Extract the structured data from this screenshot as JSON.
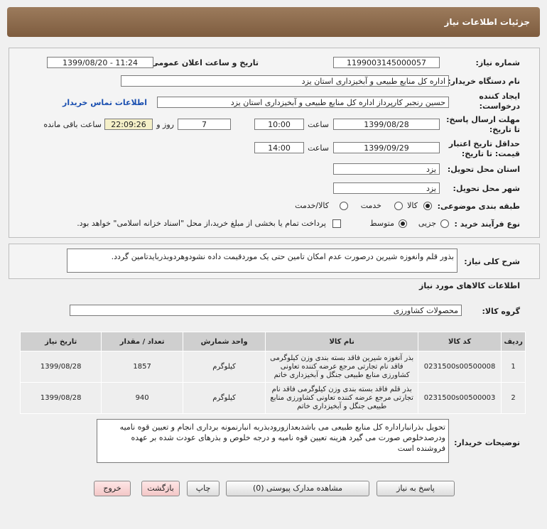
{
  "header": {
    "title": "جزئیات اطلاعات نیاز"
  },
  "form": {
    "need_number_label": "شماره نیاز:",
    "need_number": "1199003145000057",
    "announce_label": "تاریخ و ساعت اعلان عمومی:",
    "announce_value": "1399/08/20 - 11:24",
    "buyer_label": "نام دستگاه خریدار:",
    "buyer_value": "اداره کل منابع طبیعی و آبخیزداری استان یزد",
    "creator_label": "ایجاد کننده درخواست:",
    "creator_value": "حسین رنجبر کارپرداز  اداره کل منابع طبیعی و آبخیزداری استان یزد",
    "contact_link": "اطلاعات تماس خریدار",
    "deadline_label": "مهلت ارسال پاسخ: تا تاریخ:",
    "deadline_date": "1399/08/28",
    "time_label": "ساعت",
    "deadline_time": "10:00",
    "days_value": "7",
    "days_label": "روز و",
    "remaining_time": "22:09:26",
    "remaining_label": "ساعت باقی مانده",
    "validity_label": "حداقل تاریخ اعتبار قیمت: تا تاریخ:",
    "validity_date": "1399/09/29",
    "validity_time_label": "ساعت",
    "validity_time": "14:00",
    "province_label": "استان محل تحویل:",
    "province_value": "یزد",
    "city_label": "شهر محل تحویل:",
    "city_value": "یزد",
    "category_label": "طبقه بندی موضوعی:",
    "category_options": [
      "کالا",
      "خدمت",
      "کالا/خدمت"
    ],
    "category_selected": "کالا",
    "process_label": "نوع فرآیند خرید :",
    "process_options": [
      "جزیی",
      "متوسط"
    ],
    "process_selected": "متوسط",
    "payment_note": "پرداخت تمام یا بخشی از مبلغ خرید،از محل \"اسناد خزانه اسلامی\" خواهد بود."
  },
  "summary": {
    "label": "شرح کلی نیاز:",
    "text": "بذور قلم وانغوزه شیرین درصورت عدم امکان تامین حتی یک موردقیمت داده نشودوهردوبذربایدتامین گردد."
  },
  "goods": {
    "section_title": "اطلاعات کالاهای مورد نیاز",
    "group_label": "گروه کالا:",
    "group_value": "محصولات کشاورزی",
    "columns": [
      "ردیف",
      "کد کالا",
      "نام کالا",
      "واحد شمارش",
      "تعداد / مقدار",
      "تاریخ نیاز"
    ],
    "rows": [
      {
        "index": "1",
        "code": "0231500s00500008",
        "name": "بذر آنغوزه شیرین فاقد بسته بندی وزن کیلوگرمی فاقد نام تجارتی مرجع عرضه کننده تعاونی کشاورزی منابع طبیعی جنگل و آبخیزداری خاتم",
        "unit": "کیلوگرم",
        "qty": "1857",
        "date": "1399/08/28"
      },
      {
        "index": "2",
        "code": "0231500s00500003",
        "name": "بذر قلم فاقد بسته بندی وزن کیلوگرمی فاقد نام تجارتی مرجع عرضه کننده تعاونی کشاورزی منابع طبیعی جنگل و آبخیزداری خاتم",
        "unit": "کیلوگرم",
        "qty": "940",
        "date": "1399/08/28"
      }
    ]
  },
  "buyer_notes": {
    "label": "توضیحات خریدار:",
    "text": "تحویل بذرانباراداره کل منابع طبیعی می باشدبعدازورودبذربه انبارنمونه برداری انجام  و تعیین قوه نامیه ودرصدخلوص  صورت می گیرد هزینه تعیین قوه نامیه و درجه خلوص و بذرهای عودت شده بر عهده فروشنده است"
  },
  "buttons": {
    "reply": "پاسخ به نیاز",
    "attachments": "مشاهده مدارک پیوستی (0)",
    "print": "چاپ",
    "back": "بازگشت",
    "exit": "خروج"
  },
  "colors": {
    "title_bar": "#8b6a4c",
    "link": "#1a4fb0",
    "remaining_bg": "#f5f0c8"
  }
}
